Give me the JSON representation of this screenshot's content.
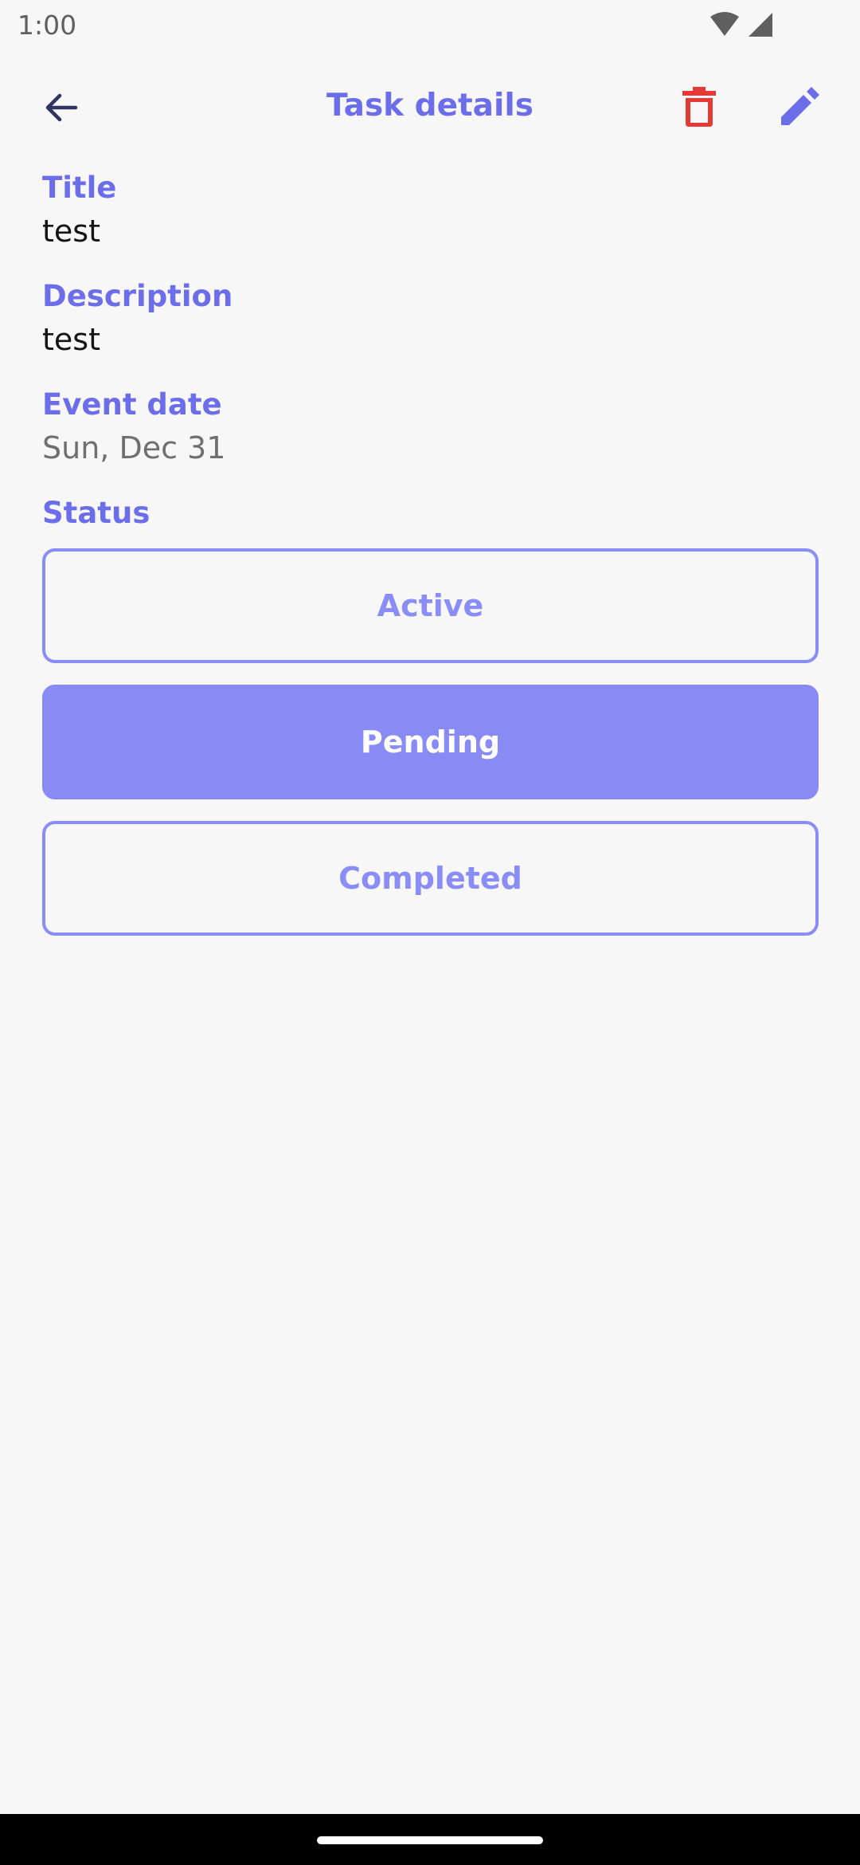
{
  "status_bar": {
    "time": "1:00",
    "icons": [
      "wifi-icon",
      "cellular-signal-icon"
    ]
  },
  "app_bar": {
    "title": "Task details",
    "back_icon": "arrow-back-icon",
    "delete_icon": "trash-icon",
    "edit_icon": "pencil-icon"
  },
  "fields": {
    "title": {
      "label": "Title",
      "value": "test"
    },
    "description": {
      "label": "Description",
      "value": "test"
    },
    "event_date": {
      "label": "Event date",
      "value": "Sun, Dec 31"
    }
  },
  "status": {
    "label": "Status",
    "selected": "Pending",
    "options": [
      {
        "label": "Active",
        "selected": false
      },
      {
        "label": "Pending",
        "selected": true
      },
      {
        "label": "Completed",
        "selected": false
      }
    ]
  },
  "colors": {
    "accent": "#6b6ee8",
    "selected_fill": "#898bf5",
    "outline": "#8a8df5",
    "delete": "#e53935",
    "background": "#f7f7f7"
  }
}
